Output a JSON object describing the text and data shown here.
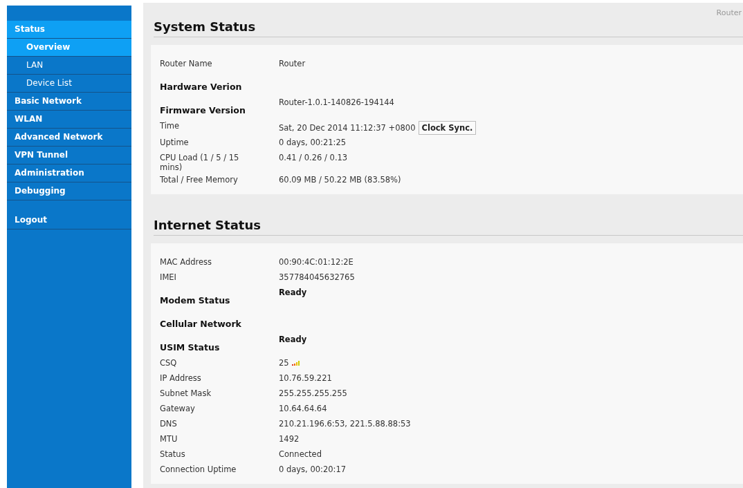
{
  "sidebar": {
    "items": [
      {
        "label": "Status",
        "selected": true,
        "children": [
          {
            "label": "Overview",
            "selected": true
          },
          {
            "label": "LAN",
            "selected": false
          },
          {
            "label": "Device List",
            "selected": false
          }
        ]
      },
      {
        "label": "Basic Network",
        "selected": false
      },
      {
        "label": "WLAN",
        "selected": false
      },
      {
        "label": "Advanced Network",
        "selected": false
      },
      {
        "label": "VPN Tunnel",
        "selected": false
      },
      {
        "label": "Administration",
        "selected": false
      },
      {
        "label": "Debugging",
        "selected": false
      },
      {
        "label": "Logout",
        "selected": false,
        "separated": true
      }
    ]
  },
  "header": {
    "breadcrumb": "Router"
  },
  "sections": [
    {
      "title": "System Status",
      "rows": [
        {
          "kind": "text",
          "label": "Router Name",
          "value": "Router"
        },
        {
          "kind": "bold",
          "label": "Hardware Verion"
        },
        {
          "kind": "bold",
          "label": "Firmware Version",
          "value": "Router-1.0.1-140826-194144"
        },
        {
          "kind": "button",
          "label": "Time",
          "value": "Sat, 20 Dec 2014 11:12:37 +0800",
          "button": "Clock Sync."
        },
        {
          "kind": "text",
          "label": "Uptime",
          "value": "0 days, 00:21:25"
        },
        {
          "kind": "text",
          "label": "CPU Load (1 / 5 / 15 mins)",
          "value": "0.41 / 0.26 / 0.13"
        },
        {
          "kind": "text",
          "label": "Total / Free Memory",
          "value": "60.09 MB / 50.22 MB (83.58%)"
        }
      ]
    },
    {
      "title": "Internet Status",
      "rows": [
        {
          "kind": "text",
          "label": "MAC Address",
          "value": "00:90:4C:01:12:2E"
        },
        {
          "kind": "text",
          "label": "IMEI",
          "value": "357784045632765"
        },
        {
          "kind": "status",
          "label": "Modem Status",
          "value": "Ready"
        },
        {
          "kind": "bold",
          "label": "Cellular Network"
        },
        {
          "kind": "status",
          "label": "USIM Status",
          "value": "Ready"
        },
        {
          "kind": "signal",
          "label": "CSQ",
          "value": "25"
        },
        {
          "kind": "text",
          "label": "IP Address",
          "value": "10.76.59.221"
        },
        {
          "kind": "text",
          "label": "Subnet Mask",
          "value": "255.255.255.255"
        },
        {
          "kind": "text",
          "label": "Gateway",
          "value": "10.64.64.64"
        },
        {
          "kind": "text",
          "label": "DNS",
          "value": "210.21.196.6:53, 221.5.88.88:53"
        },
        {
          "kind": "text",
          "label": "MTU",
          "value": "1492"
        },
        {
          "kind": "text",
          "label": "Status",
          "value": "Connected"
        },
        {
          "kind": "text",
          "label": "Connection Uptime",
          "value": "0 days, 00:20:17"
        }
      ]
    }
  ]
}
